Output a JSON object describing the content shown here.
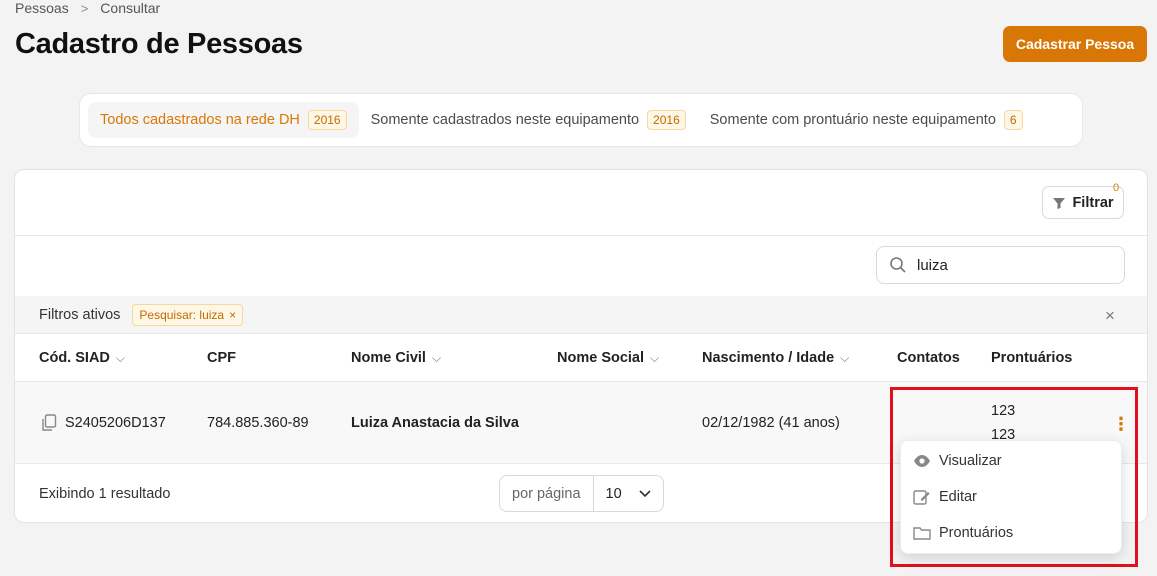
{
  "breadcrumb": {
    "items": [
      "Pessoas",
      "Consultar"
    ],
    "separator": ">"
  },
  "page_title": "Cadastro de Pessoas",
  "primary_action": "Cadastrar Pessoa",
  "tabs": [
    {
      "label": "Todos cadastrados na rede DH",
      "count": "2016",
      "active": true
    },
    {
      "label": "Somente cadastrados neste equipamento",
      "count": "2016",
      "active": false
    },
    {
      "label": "Somente com prontuário neste equipamento",
      "count": "6",
      "active": false
    }
  ],
  "toolbar": {
    "filter_label": "Filtrar",
    "filter_count": "0"
  },
  "search": {
    "value": "luiza"
  },
  "active_filters": {
    "label": "Filtros ativos",
    "chip": "Pesquisar: luiza",
    "chip_close": "×",
    "clear": "×"
  },
  "table": {
    "headers": [
      "Cód. SIAD",
      "CPF",
      "Nome Civil",
      "Nome Social",
      "Nascimento / Idade",
      "Contatos",
      "Prontuários"
    ],
    "row": {
      "code": "S2405206D137",
      "cpf": "784.885.360-89",
      "nome_civil": "Luiza Anastacia da Silva",
      "nome_social": "",
      "nascimento": "02/12/1982 (41 anos)",
      "contatos": "",
      "prontuarios": [
        "123",
        "123"
      ]
    }
  },
  "footer": {
    "results": "Exibindo 1 resultado",
    "per_page_label": "por página",
    "per_page_value": "10"
  },
  "row_menu": {
    "items": [
      "Visualizar",
      "Editar",
      "Prontuários"
    ]
  },
  "colors": {
    "accent": "#d97706",
    "highlight": "#e0101c"
  }
}
